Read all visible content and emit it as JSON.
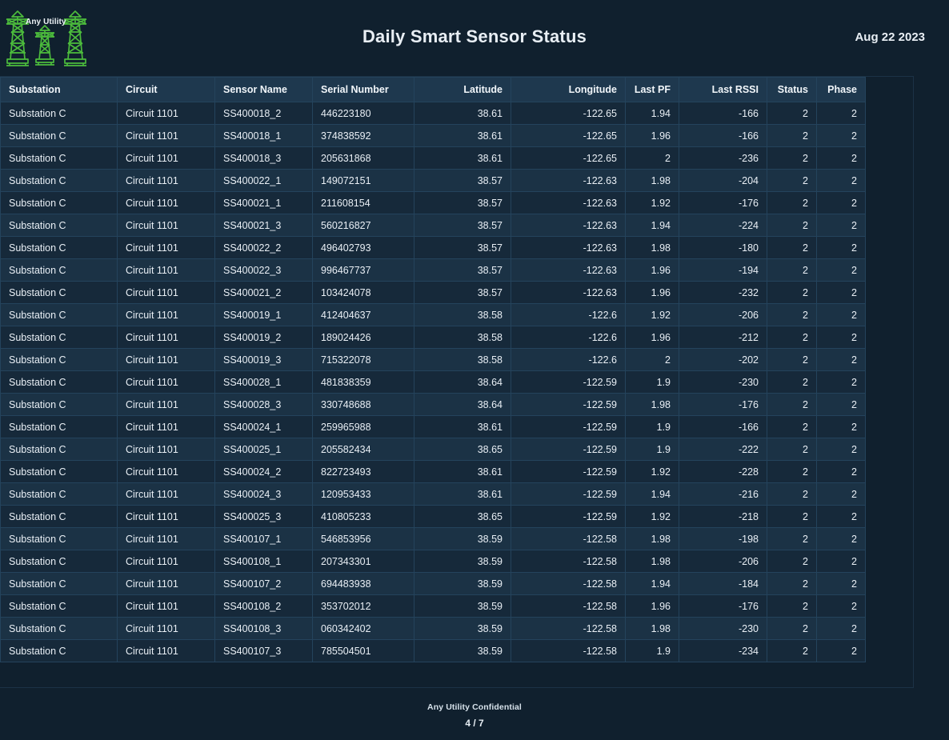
{
  "header": {
    "logo_name": "Any Utility",
    "logo_icon": "transmission-towers-icon",
    "logo_color": "#4cbb3c",
    "title": "Daily Smart Sensor Status",
    "date": "Aug 22 2023"
  },
  "table": {
    "columns": [
      {
        "label": "Substation",
        "align": "left"
      },
      {
        "label": "Circuit",
        "align": "left"
      },
      {
        "label": "Sensor Name",
        "align": "left"
      },
      {
        "label": "Serial Number",
        "align": "left"
      },
      {
        "label": "Latitude",
        "align": "right"
      },
      {
        "label": "Longitude",
        "align": "right"
      },
      {
        "label": "Last PF",
        "align": "right"
      },
      {
        "label": "Last RSSI",
        "align": "right"
      },
      {
        "label": "Status",
        "align": "right"
      },
      {
        "label": "Phase",
        "align": "right"
      }
    ],
    "rows": [
      [
        "Substation  C",
        "Circuit 1101",
        "SS400018_2",
        "446223180",
        "38.61",
        "-122.65",
        "1.94",
        "-166",
        "2",
        "2"
      ],
      [
        "Substation  C",
        "Circuit 1101",
        "SS400018_1",
        "374838592",
        "38.61",
        "-122.65",
        "1.96",
        "-166",
        "2",
        "2"
      ],
      [
        "Substation  C",
        "Circuit 1101",
        "SS400018_3",
        "205631868",
        "38.61",
        "-122.65",
        "2",
        "-236",
        "2",
        "2"
      ],
      [
        "Substation  C",
        "Circuit 1101",
        "SS400022_1",
        "149072151",
        "38.57",
        "-122.63",
        "1.98",
        "-204",
        "2",
        "2"
      ],
      [
        "Substation  C",
        "Circuit 1101",
        "SS400021_1",
        "211608154",
        "38.57",
        "-122.63",
        "1.92",
        "-176",
        "2",
        "2"
      ],
      [
        "Substation  C",
        "Circuit 1101",
        "SS400021_3",
        "560216827",
        "38.57",
        "-122.63",
        "1.94",
        "-224",
        "2",
        "2"
      ],
      [
        "Substation  C",
        "Circuit 1101",
        "SS400022_2",
        "496402793",
        "38.57",
        "-122.63",
        "1.98",
        "-180",
        "2",
        "2"
      ],
      [
        "Substation  C",
        "Circuit 1101",
        "SS400022_3",
        "996467737",
        "38.57",
        "-122.63",
        "1.96",
        "-194",
        "2",
        "2"
      ],
      [
        "Substation  C",
        "Circuit 1101",
        "SS400021_2",
        "103424078",
        "38.57",
        "-122.63",
        "1.96",
        "-232",
        "2",
        "2"
      ],
      [
        "Substation  C",
        "Circuit 1101",
        "SS400019_1",
        "412404637",
        "38.58",
        "-122.6",
        "1.92",
        "-206",
        "2",
        "2"
      ],
      [
        "Substation  C",
        "Circuit 1101",
        "SS400019_2",
        "189024426",
        "38.58",
        "-122.6",
        "1.96",
        "-212",
        "2",
        "2"
      ],
      [
        "Substation  C",
        "Circuit 1101",
        "SS400019_3",
        "715322078",
        "38.58",
        "-122.6",
        "2",
        "-202",
        "2",
        "2"
      ],
      [
        "Substation  C",
        "Circuit 1101",
        "SS400028_1",
        "481838359",
        "38.64",
        "-122.59",
        "1.9",
        "-230",
        "2",
        "2"
      ],
      [
        "Substation  C",
        "Circuit 1101",
        "SS400028_3",
        "330748688",
        "38.64",
        "-122.59",
        "1.98",
        "-176",
        "2",
        "2"
      ],
      [
        "Substation  C",
        "Circuit 1101",
        "SS400024_1",
        "259965988",
        "38.61",
        "-122.59",
        "1.9",
        "-166",
        "2",
        "2"
      ],
      [
        "Substation  C",
        "Circuit 1101",
        "SS400025_1",
        "205582434",
        "38.65",
        "-122.59",
        "1.9",
        "-222",
        "2",
        "2"
      ],
      [
        "Substation  C",
        "Circuit 1101",
        "SS400024_2",
        "822723493",
        "38.61",
        "-122.59",
        "1.92",
        "-228",
        "2",
        "2"
      ],
      [
        "Substation  C",
        "Circuit 1101",
        "SS400024_3",
        "120953433",
        "38.61",
        "-122.59",
        "1.94",
        "-216",
        "2",
        "2"
      ],
      [
        "Substation  C",
        "Circuit 1101",
        "SS400025_3",
        "410805233",
        "38.65",
        "-122.59",
        "1.92",
        "-218",
        "2",
        "2"
      ],
      [
        "Substation  C",
        "Circuit 1101",
        "SS400107_1",
        "546853956",
        "38.59",
        "-122.58",
        "1.98",
        "-198",
        "2",
        "2"
      ],
      [
        "Substation  C",
        "Circuit 1101",
        "SS400108_1",
        "207343301",
        "38.59",
        "-122.58",
        "1.98",
        "-206",
        "2",
        "2"
      ],
      [
        "Substation  C",
        "Circuit 1101",
        "SS400107_2",
        "694483938",
        "38.59",
        "-122.58",
        "1.94",
        "-184",
        "2",
        "2"
      ],
      [
        "Substation  C",
        "Circuit 1101",
        "SS400108_2",
        "353702012",
        "38.59",
        "-122.58",
        "1.96",
        "-176",
        "2",
        "2"
      ],
      [
        "Substation  C",
        "Circuit 1101",
        "SS400108_3",
        "060342402",
        "38.59",
        "-122.58",
        "1.98",
        "-230",
        "2",
        "2"
      ],
      [
        "Substation  C",
        "Circuit 1101",
        "SS400107_3",
        "785504501",
        "38.59",
        "-122.58",
        "1.9",
        "-234",
        "2",
        "2"
      ]
    ]
  },
  "footer": {
    "confidential": "Any Utility Confidential",
    "page": "4 / 7"
  },
  "colors": {
    "background": "#10202e",
    "header_row": "#1e384e",
    "row_odd": "#16293a",
    "row_even": "#1b3245",
    "grid_line": "#24435c",
    "text": "#e9eff5",
    "logo_green": "#4cbb3c"
  }
}
